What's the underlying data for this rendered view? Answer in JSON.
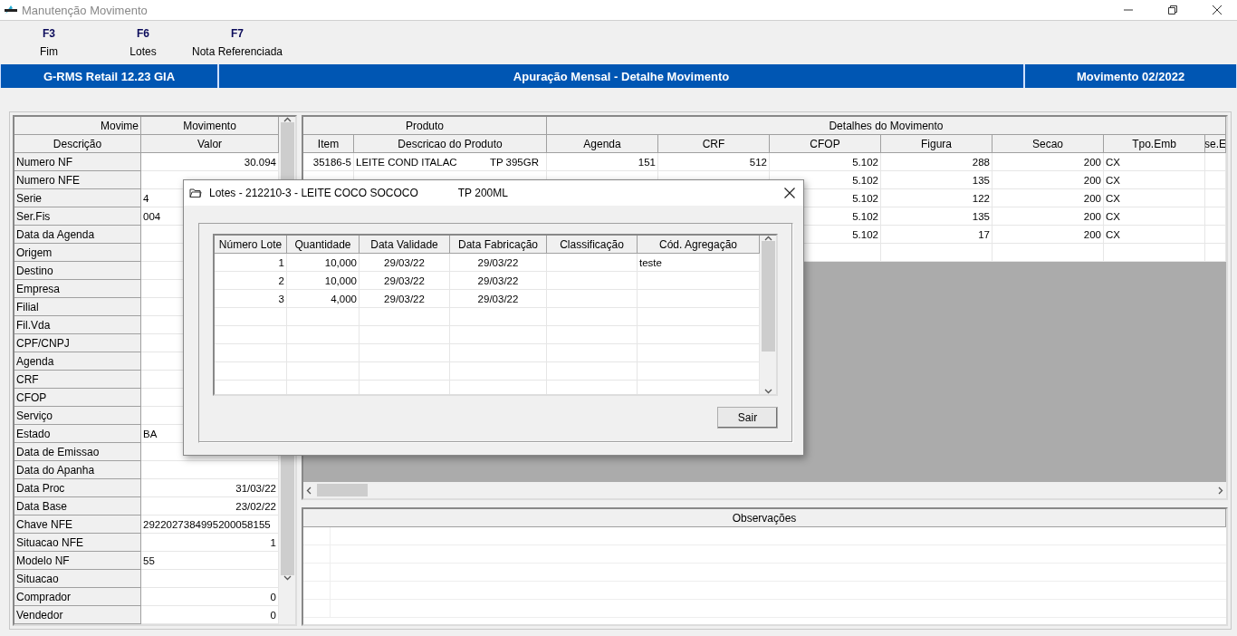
{
  "window": {
    "title": "Manutenção Movimento"
  },
  "toolbar": [
    {
      "key": "F3",
      "label": "Fim"
    },
    {
      "key": "F6",
      "label": "Lotes"
    },
    {
      "key": "F7",
      "label": "Nota Referenciada"
    }
  ],
  "banner": {
    "product": "G-RMS Retail 12.23 GIA",
    "screen": "Apuração Mensal - Detalhe Movimento",
    "period": "Movimento 02/2022"
  },
  "movement_grid": {
    "group_headers": [
      "Movime",
      "Movimento"
    ],
    "columns": [
      "Descrição",
      "Valor"
    ],
    "rows": [
      {
        "label": "Numero NF",
        "value": "30.094",
        "kind": "number"
      },
      {
        "label": "Numero NFE"
      },
      {
        "label": "Serie",
        "value": "4",
        "kind": "text"
      },
      {
        "label": "Ser.Fis",
        "value": "004",
        "kind": "text"
      },
      {
        "label": "Data da Agenda"
      },
      {
        "label": "Origem"
      },
      {
        "label": "Destino"
      },
      {
        "label": "Empresa"
      },
      {
        "label": "Filial"
      },
      {
        "label": "Fil.Vda"
      },
      {
        "label": "CPF/CNPJ"
      },
      {
        "label": "Agenda"
      },
      {
        "label": "CRF"
      },
      {
        "label": "CFOP"
      },
      {
        "label": "Serviço"
      },
      {
        "label": "Estado",
        "value": "BA",
        "kind": "text"
      },
      {
        "label": "Data de Emissao"
      },
      {
        "label": "Data do Apanha"
      },
      {
        "label": "Data Proc",
        "value": "31/03/22",
        "kind": "number"
      },
      {
        "label": "Data Base",
        "value": "23/02/22",
        "kind": "number"
      },
      {
        "label": "Chave NFE",
        "value": "2922027384995200058155",
        "kind": "text"
      },
      {
        "label": "Situacao NFE",
        "value": "1",
        "kind": "number"
      },
      {
        "label": "Modelo NF",
        "value": "55",
        "kind": "text"
      },
      {
        "label": "Situacao"
      },
      {
        "label": "Comprador",
        "value": "0",
        "kind": "number"
      },
      {
        "label": "Vendedor",
        "value": "0",
        "kind": "number"
      }
    ]
  },
  "detail_grid": {
    "groups": [
      "Produto",
      "Detalhes do Movimento"
    ],
    "columns": [
      "Item",
      "Descricao do Produto",
      "Agenda",
      "CRF",
      "CFOP",
      "Figura",
      "Secao",
      "Tpo.Emb",
      "se.E"
    ],
    "rows": [
      {
        "item": "35186-5",
        "description": "LEITE COND ITALAC",
        "package": "TP 395GR",
        "agenda": "151",
        "crf": "512",
        "cfop": "5.102",
        "figura": "288",
        "secao": "200",
        "tpo_emb": "CX"
      },
      {
        "cfop": "5.102",
        "figura": "135",
        "secao": "200",
        "tpo_emb": "CX"
      },
      {
        "cfop": "5.102",
        "figura": "122",
        "secao": "200",
        "tpo_emb": "CX"
      },
      {
        "cfop": "5.102",
        "figura": "135",
        "secao": "200",
        "tpo_emb": "CX"
      },
      {
        "cfop": "5.102",
        "figura": "17",
        "secao": "200",
        "tpo_emb": "CX"
      }
    ]
  },
  "observations": {
    "title": "Observações"
  },
  "lots_dialog": {
    "title": "Lotes - 212210-3 - LEITE COCO SOCOCO",
    "subtitle": "TP 200ML",
    "columns": [
      "Número Lote",
      "Quantidade",
      "Data Validade",
      "Data Fabricação",
      "Classificação",
      "Cód. Agregação"
    ],
    "rows": [
      {
        "lote": "1",
        "quantidade": "10,000",
        "validade": "29/03/22",
        "fabricacao": "29/03/22",
        "agregacao": "teste"
      },
      {
        "lote": "2",
        "quantidade": "10,000",
        "validade": "29/03/22",
        "fabricacao": "29/03/22"
      },
      {
        "lote": "3",
        "quantidade": "4,000",
        "validade": "29/03/22",
        "fabricacao": "29/03/22"
      }
    ],
    "close_button": "Sair"
  }
}
